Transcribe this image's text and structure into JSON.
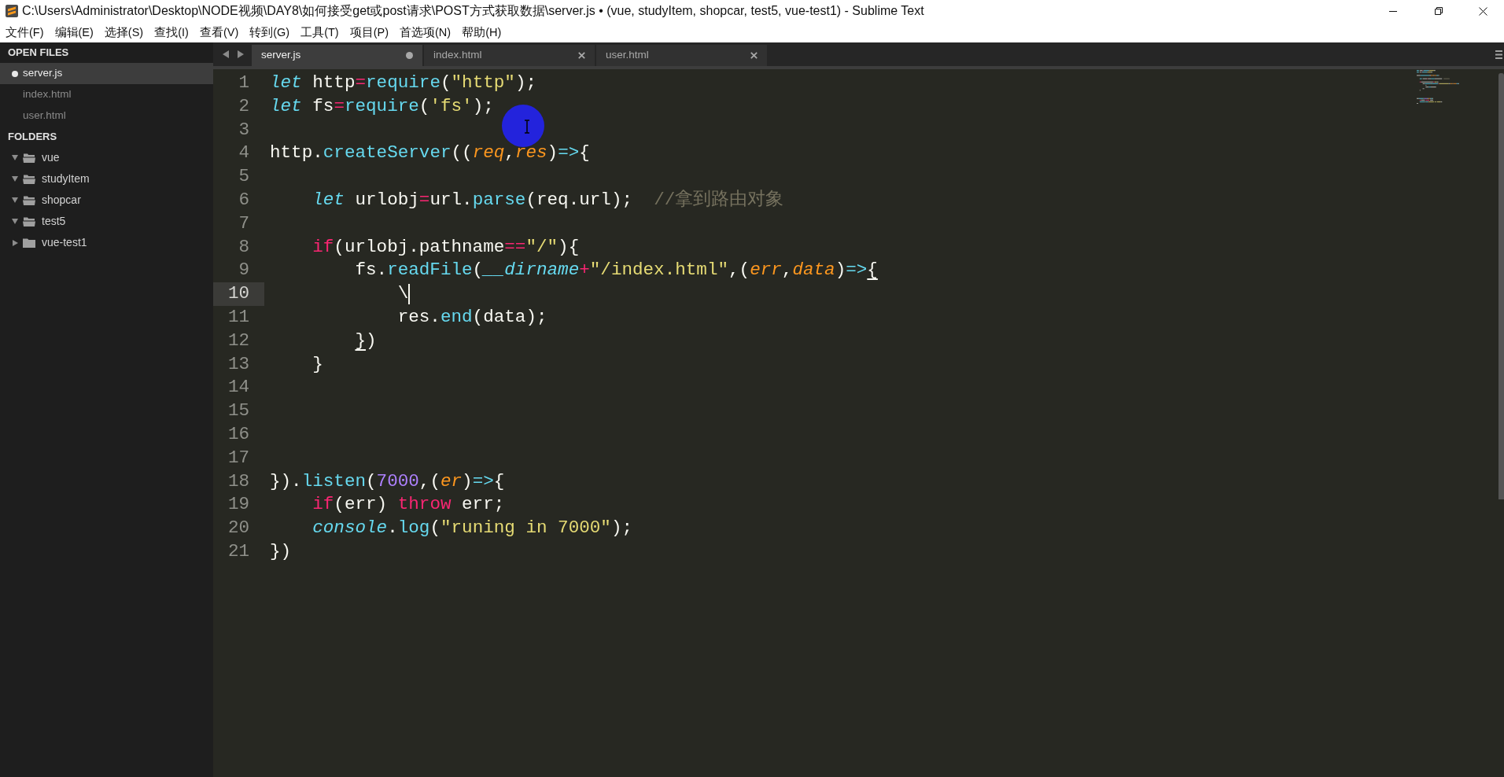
{
  "window": {
    "title": "C:\\Users\\Administrator\\Desktop\\NODE视频\\DAY8\\如何接受get或post请求\\POST方式获取数据\\server.js • (vue, studyItem, shopcar, test5, vue-test1) - Sublime Text"
  },
  "menu_bar": [
    "文件(F)",
    "编辑(E)",
    "选择(S)",
    "查找(I)",
    "查看(V)",
    "转到(G)",
    "工具(T)",
    "项目(P)",
    "首选项(N)",
    "帮助(H)"
  ],
  "sidebar": {
    "open_files": {
      "title": "OPEN FILES",
      "items": [
        {
          "label": "server.js",
          "selected": true,
          "modified": true
        },
        {
          "label": "index.html",
          "selected": false,
          "modified": false
        },
        {
          "label": "user.html",
          "selected": false,
          "modified": false
        }
      ]
    },
    "folders": {
      "title": "FOLDERS",
      "items": [
        {
          "label": "vue",
          "expanded": true
        },
        {
          "label": "studyItem",
          "expanded": true
        },
        {
          "label": "shopcar",
          "expanded": true
        },
        {
          "label": "test5",
          "expanded": true
        },
        {
          "label": "vue-test1",
          "expanded": false
        }
      ]
    }
  },
  "tabs": [
    {
      "label": "server.js",
      "selected": true,
      "modified": true
    },
    {
      "label": "index.html",
      "selected": false,
      "modified": false
    },
    {
      "label": "user.html",
      "selected": false,
      "modified": false
    }
  ],
  "editor": {
    "lines": [
      {
        "number": "1",
        "current": false,
        "tokens": [
          {
            "text": "let",
            "kind": "storage"
          },
          {
            "text": " http",
            "kind": "plain"
          },
          {
            "text": "=",
            "kind": "operator"
          },
          {
            "text": "require",
            "kind": "function"
          },
          {
            "text": "(",
            "kind": "plain"
          },
          {
            "text": "\"http\"",
            "kind": "string"
          },
          {
            "text": ");",
            "kind": "plain"
          }
        ]
      },
      {
        "number": "2",
        "current": false,
        "tokens": [
          {
            "text": "let",
            "kind": "storage"
          },
          {
            "text": " fs",
            "kind": "plain"
          },
          {
            "text": "=",
            "kind": "operator"
          },
          {
            "text": "require",
            "kind": "function"
          },
          {
            "text": "(",
            "kind": "plain"
          },
          {
            "text": "'fs'",
            "kind": "string"
          },
          {
            "text": ");",
            "kind": "plain"
          }
        ]
      },
      {
        "number": "3",
        "current": false
      },
      {
        "number": "4",
        "current": false,
        "tokens": [
          {
            "text": "http.",
            "kind": "plain"
          },
          {
            "text": "createServer",
            "kind": "function"
          },
          {
            "text": "((",
            "kind": "plain"
          },
          {
            "text": "req",
            "kind": "param"
          },
          {
            "text": ",",
            "kind": "plain"
          },
          {
            "text": "res",
            "kind": "param"
          },
          {
            "text": ")",
            "kind": "plain"
          },
          {
            "text": "=>",
            "kind": "arrow"
          },
          {
            "text": "{",
            "kind": "plain"
          }
        ]
      },
      {
        "number": "5",
        "current": false
      },
      {
        "number": "6",
        "current": false,
        "tokens": [
          {
            "text": "    let",
            "kind": "storage"
          },
          {
            "text": " urlobj",
            "kind": "plain"
          },
          {
            "text": "=",
            "kind": "operator"
          },
          {
            "text": "url.",
            "kind": "plain"
          },
          {
            "text": "parse",
            "kind": "function"
          },
          {
            "text": "(req.url);  ",
            "kind": "plain"
          },
          {
            "text": "//拿到路由对象",
            "kind": "comment"
          }
        ]
      },
      {
        "number": "7",
        "current": false
      },
      {
        "number": "8",
        "current": false,
        "tokens": [
          {
            "text": "    if",
            "kind": "keyword"
          },
          {
            "text": "(urlobj.pathname",
            "kind": "plain"
          },
          {
            "text": "==",
            "kind": "operator"
          },
          {
            "text": "\"/\"",
            "kind": "string"
          },
          {
            "text": "){",
            "kind": "plain"
          }
        ]
      },
      {
        "number": "9",
        "current": false,
        "tokens": [
          {
            "text": "        fs.",
            "kind": "plain"
          },
          {
            "text": "readFile",
            "kind": "function"
          },
          {
            "text": "(",
            "kind": "plain"
          },
          {
            "text": "__dirname",
            "kind": "support"
          },
          {
            "text": "+",
            "kind": "operator"
          },
          {
            "text": "\"/index.html\"",
            "kind": "string"
          },
          {
            "text": ",(",
            "kind": "plain"
          },
          {
            "text": "err",
            "kind": "param"
          },
          {
            "text": ",",
            "kind": "plain"
          },
          {
            "text": "data",
            "kind": "param"
          },
          {
            "text": ")",
            "kind": "plain"
          },
          {
            "text": "=>",
            "kind": "arrow"
          },
          {
            "text": "{",
            "kind": "bracket"
          }
        ]
      },
      {
        "number": "10",
        "current": true,
        "tokens": [
          {
            "text": "            \\",
            "kind": "plain"
          }
        ]
      },
      {
        "number": "11",
        "current": false,
        "tokens": [
          {
            "text": "            res.",
            "kind": "plain"
          },
          {
            "text": "end",
            "kind": "function"
          },
          {
            "text": "(data);",
            "kind": "plain"
          }
        ]
      },
      {
        "number": "12",
        "current": false,
        "tokens": [
          {
            "text": "        }",
            "kind": "bracket"
          },
          {
            "text": ")",
            "kind": "plain"
          }
        ]
      },
      {
        "number": "13",
        "current": false,
        "tokens": [
          {
            "text": "    }",
            "kind": "plain"
          }
        ]
      },
      {
        "number": "14",
        "current": false
      },
      {
        "number": "15",
        "current": false
      },
      {
        "number": "16",
        "current": false
      },
      {
        "number": "17",
        "current": false
      },
      {
        "number": "18",
        "current": false,
        "tokens": [
          {
            "text": "}).",
            "kind": "plain"
          },
          {
            "text": "listen",
            "kind": "function"
          },
          {
            "text": "(",
            "kind": "plain"
          },
          {
            "text": "7000",
            "kind": "number"
          },
          {
            "text": ",(",
            "kind": "plain"
          },
          {
            "text": "er",
            "kind": "param"
          },
          {
            "text": ")",
            "kind": "plain"
          },
          {
            "text": "=>",
            "kind": "arrow"
          },
          {
            "text": "{",
            "kind": "plain"
          }
        ]
      },
      {
        "number": "19",
        "current": false,
        "tokens": [
          {
            "text": "    if",
            "kind": "keyword"
          },
          {
            "text": "(err) ",
            "kind": "plain"
          },
          {
            "text": "throw",
            "kind": "keyword"
          },
          {
            "text": " err;",
            "kind": "plain"
          }
        ]
      },
      {
        "number": "20",
        "current": false,
        "tokens": [
          {
            "text": "    console",
            "kind": "support"
          },
          {
            "text": ".",
            "kind": "plain"
          },
          {
            "text": "log",
            "kind": "function"
          },
          {
            "text": "(",
            "kind": "plain"
          },
          {
            "text": "\"runing in 7000\"",
            "kind": "string"
          },
          {
            "text": ");",
            "kind": "plain"
          }
        ]
      },
      {
        "number": "21",
        "current": false,
        "tokens": [
          {
            "text": "})",
            "kind": "plain"
          }
        ]
      }
    ]
  }
}
